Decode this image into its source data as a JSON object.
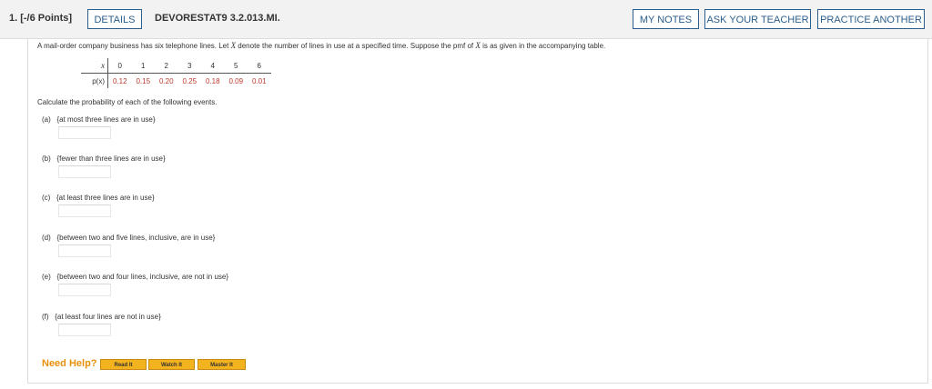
{
  "header": {
    "question_number": "1. [-/6 Points]",
    "details_label": "DETAILS",
    "source": "DEVORESTAT9 3.2.013.MI.",
    "my_notes_label": "MY NOTES",
    "ask_teacher_label": "ASK YOUR TEACHER",
    "practice_label": "PRACTICE ANOTHER"
  },
  "question": {
    "intro_1": "A mail-order company business has six telephone lines. Let ",
    "var_x": "X",
    "intro_2": " denote the number of lines in use at a specified time. Suppose the pmf of ",
    "intro_3": " is as given in the accompanying table.",
    "table": {
      "x_label": "x",
      "p_label": "p(x)",
      "x_values": [
        "0",
        "1",
        "2",
        "3",
        "4",
        "5",
        "6"
      ],
      "p_values": [
        "0.12",
        "0.15",
        "0.20",
        "0.25",
        "0.18",
        "0.09",
        "0.01"
      ]
    },
    "prompt": "Calculate the probability of each of the following events.",
    "parts": [
      {
        "label": "(a)",
        "text": "{at most three lines are in use}",
        "answer": ""
      },
      {
        "label": "(b)",
        "text": "{fewer than three lines are in use}",
        "answer": ""
      },
      {
        "label": "(c)",
        "text": "{at least three lines are in use}",
        "answer": ""
      },
      {
        "label": "(d)",
        "text": "{between two and five lines, inclusive, are in use}",
        "answer": ""
      },
      {
        "label": "(e)",
        "text": "{between two and four lines, inclusive, are not in use}",
        "answer": ""
      },
      {
        "label": "(f)",
        "text": "{at least four lines are not in use}",
        "answer": ""
      }
    ]
  },
  "help": {
    "label": "Need Help?",
    "read_label": "Read It",
    "watch_label": "Watch It",
    "master_label": "Master It"
  },
  "colors": {
    "accent": "#2b5e8c",
    "value_red": "#c0392b",
    "help_orange": "#e8900c",
    "help_button": "#f3b31f"
  }
}
